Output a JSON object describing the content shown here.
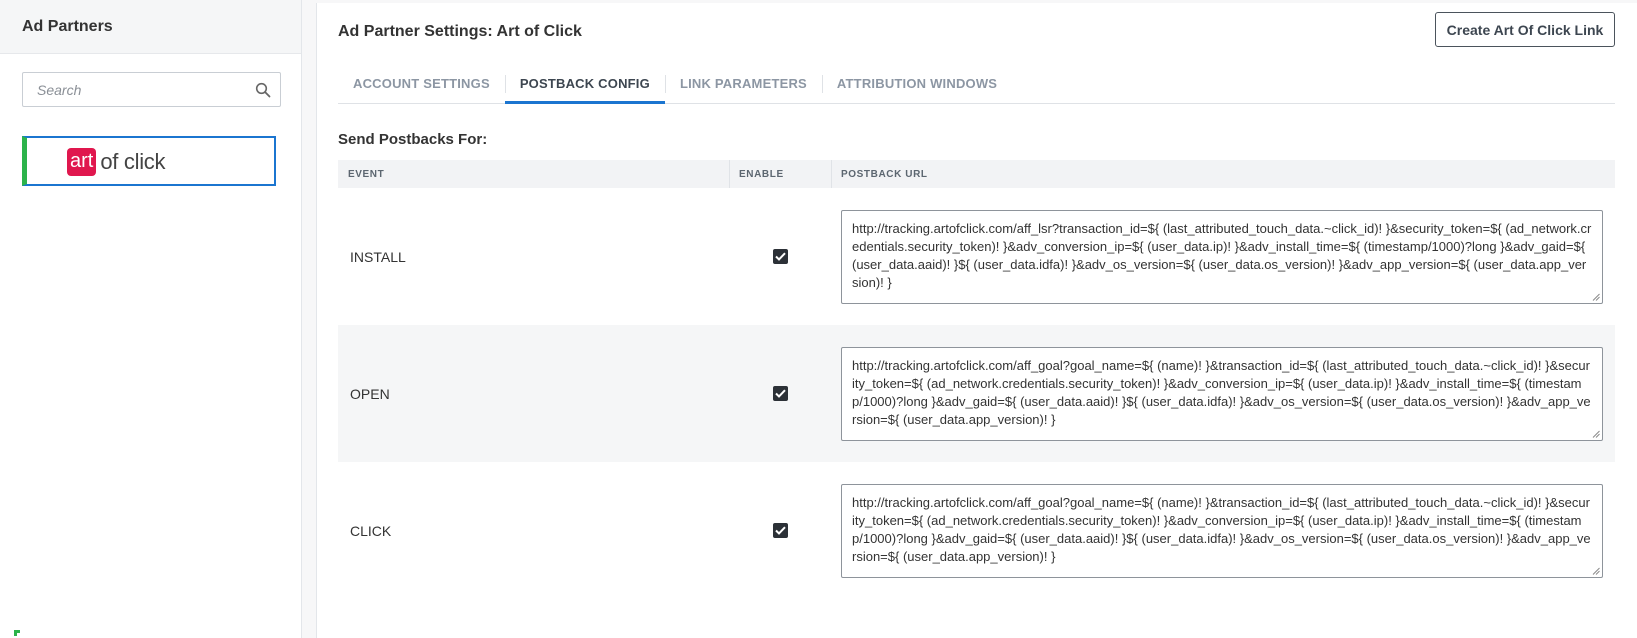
{
  "sidebar": {
    "title": "Ad Partners",
    "search_placeholder": "Search",
    "partner": {
      "logo_art": "art",
      "logo_rest": "of click"
    }
  },
  "main": {
    "title": "Ad Partner Settings: Art of Click",
    "create_button": "Create Art Of Click Link",
    "tabs": [
      {
        "label": "ACCOUNT SETTINGS"
      },
      {
        "label": "POSTBACK CONFIG",
        "active": true
      },
      {
        "label": "LINK PARAMETERS"
      },
      {
        "label": "ATTRIBUTION WINDOWS"
      }
    ],
    "section_label": "Send Postbacks For:",
    "table": {
      "headers": {
        "event": "EVENT",
        "enable": "ENABLE",
        "url": "POSTBACK URL"
      },
      "rows": [
        {
          "event": "INSTALL",
          "enabled": true,
          "url": "http://tracking.artofclick.com/aff_lsr?transaction_id=${ (last_attributed_touch_data.~click_id)! }&security_token=${ (ad_network.credentials.security_token)! }&adv_conversion_ip=${ (user_data.ip)! }&adv_install_time=${ (timestamp/1000)?long }&adv_gaid=${ (user_data.aaid)! }${ (user_data.idfa)! }&adv_os_version=${ (user_data.os_version)! }&adv_app_version=${ (user_data.app_version)! }"
        },
        {
          "event": "OPEN",
          "enabled": true,
          "url": "http://tracking.artofclick.com/aff_goal?goal_name=${ (name)! }&transaction_id=${ (last_attributed_touch_data.~click_id)! }&security_token=${ (ad_network.credentials.security_token)! }&adv_conversion_ip=${ (user_data.ip)! }&adv_install_time=${ (timestamp/1000)?long }&adv_gaid=${ (user_data.aaid)! }${ (user_data.idfa)! }&adv_os_version=${ (user_data.os_version)! }&adv_app_version=${ (user_data.app_version)! }"
        },
        {
          "event": "CLICK",
          "enabled": true,
          "url": "http://tracking.artofclick.com/aff_goal?goal_name=${ (name)! }&transaction_id=${ (last_attributed_touch_data.~click_id)! }&security_token=${ (ad_network.credentials.security_token)! }&adv_conversion_ip=${ (user_data.ip)! }&adv_install_time=${ (timestamp/1000)?long }&adv_gaid=${ (user_data.aaid)! }${ (user_data.idfa)! }&adv_os_version=${ (user_data.os_version)! }&adv_app_version=${ (user_data.app_version)! }"
        }
      ]
    }
  },
  "colors": {
    "accent": "#1b75d0",
    "partner_selected_border": "#2cb34a",
    "logo_brand": "#e0174e"
  },
  "icons": [
    "search-icon",
    "check-icon",
    "resize-handle-icon"
  ]
}
